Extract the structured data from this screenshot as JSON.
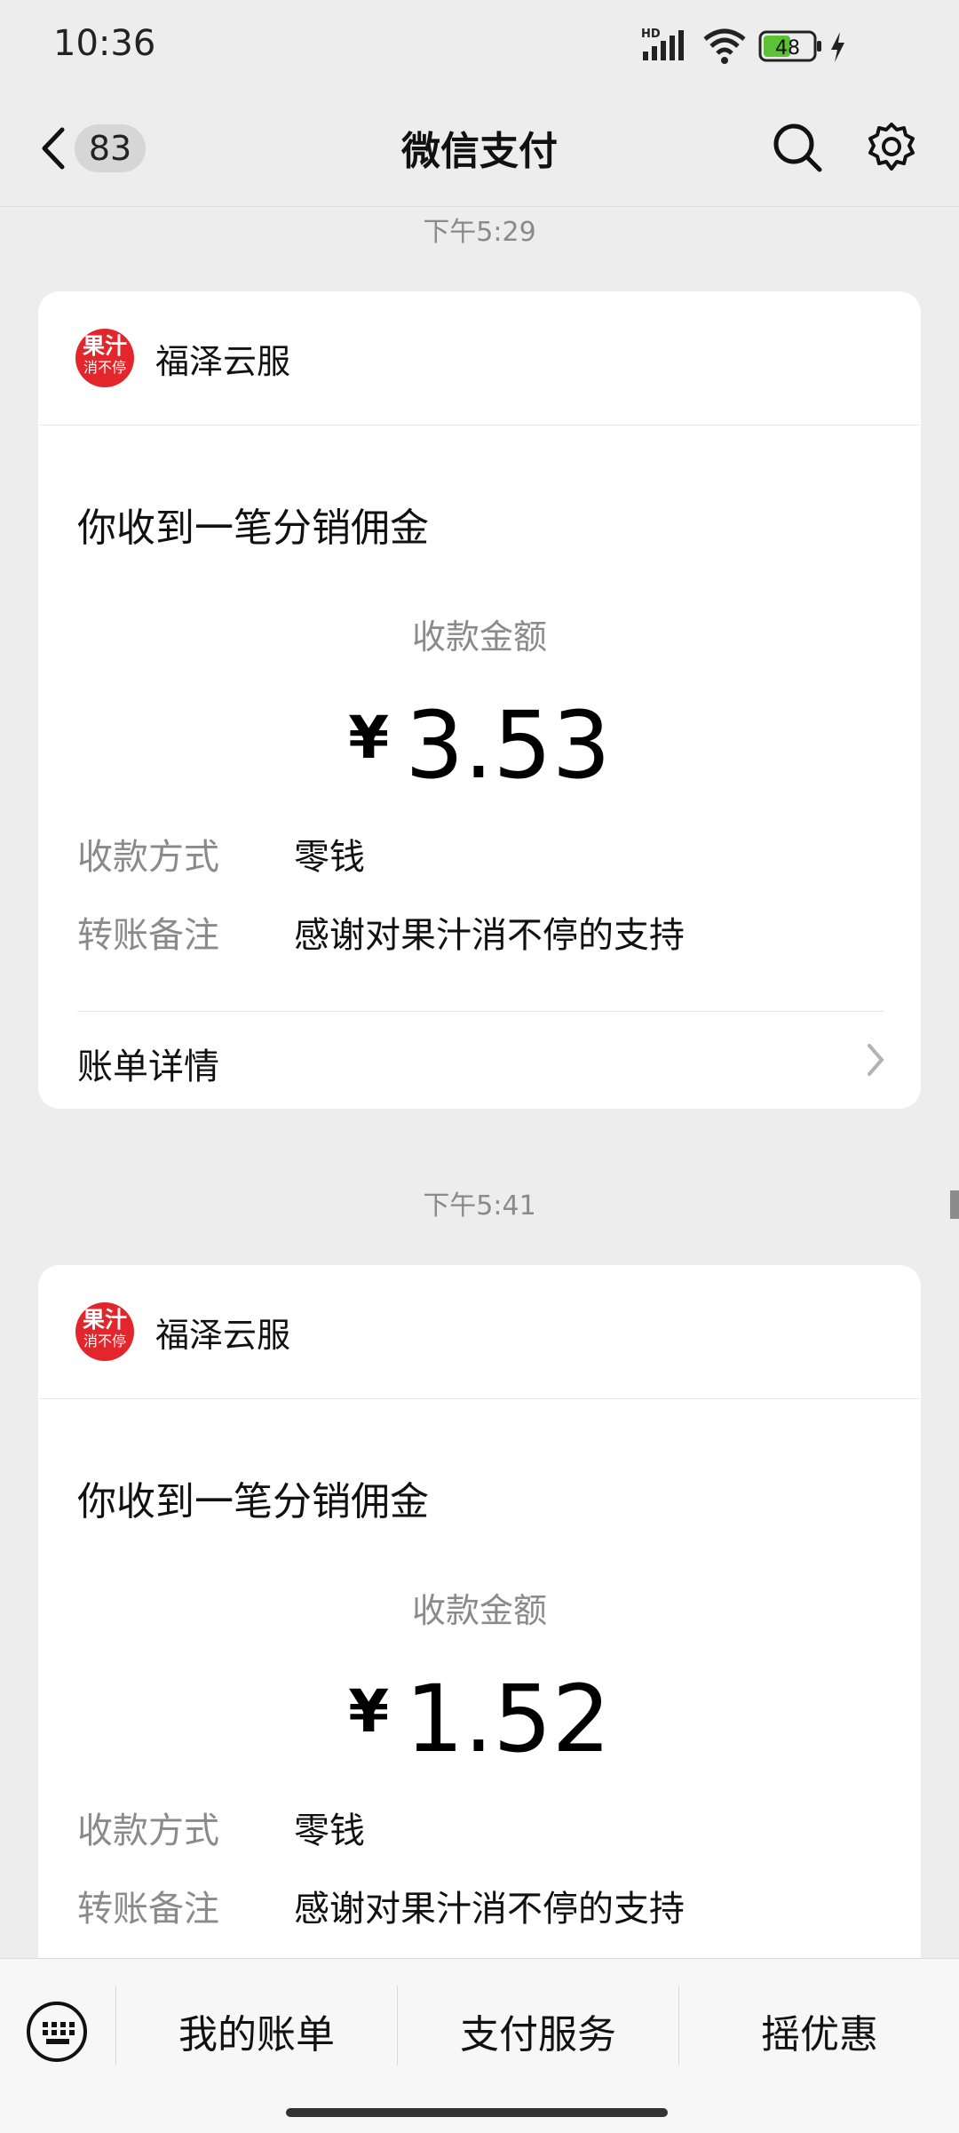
{
  "status_bar": {
    "time": "10:36",
    "network_label": "HD",
    "battery": "48",
    "icons": [
      "hd-signal-icon",
      "wifi-icon",
      "battery-icon",
      "charging-icon"
    ]
  },
  "nav": {
    "unread_count": "83",
    "title": "微信支付",
    "icons": [
      "back-icon",
      "search-icon",
      "gear-icon"
    ]
  },
  "messages": [
    {
      "timestamp": "下午5:29",
      "logo_line1": "果汁",
      "logo_line2": "消不停",
      "merchant": "福泽云服",
      "title": "你收到一笔分销佣金",
      "amount_label": "收款金额",
      "currency": "¥",
      "amount": "3.53",
      "rows": [
        {
          "label": "收款方式",
          "value": "零钱"
        },
        {
          "label": "转账备注",
          "value": "感谢对果汁消不停的支持"
        }
      ],
      "detail_label": "账单详情"
    },
    {
      "timestamp": "下午5:41",
      "logo_line1": "果汁",
      "logo_line2": "消不停",
      "merchant": "福泽云服",
      "title": "你收到一笔分销佣金",
      "amount_label": "收款金额",
      "currency": "¥",
      "amount": "1.52",
      "rows": [
        {
          "label": "收款方式",
          "value": "零钱"
        },
        {
          "label": "转账备注",
          "value": "感谢对果汁消不停的支持"
        }
      ]
    }
  ],
  "bottom_menu": {
    "items": [
      "我的账单",
      "支付服务",
      "摇优惠"
    ],
    "keyboard_icon": "keyboard-icon"
  },
  "colors": {
    "background": "#ededed",
    "logo_red": "#e2262b",
    "card": "#ffffff"
  }
}
